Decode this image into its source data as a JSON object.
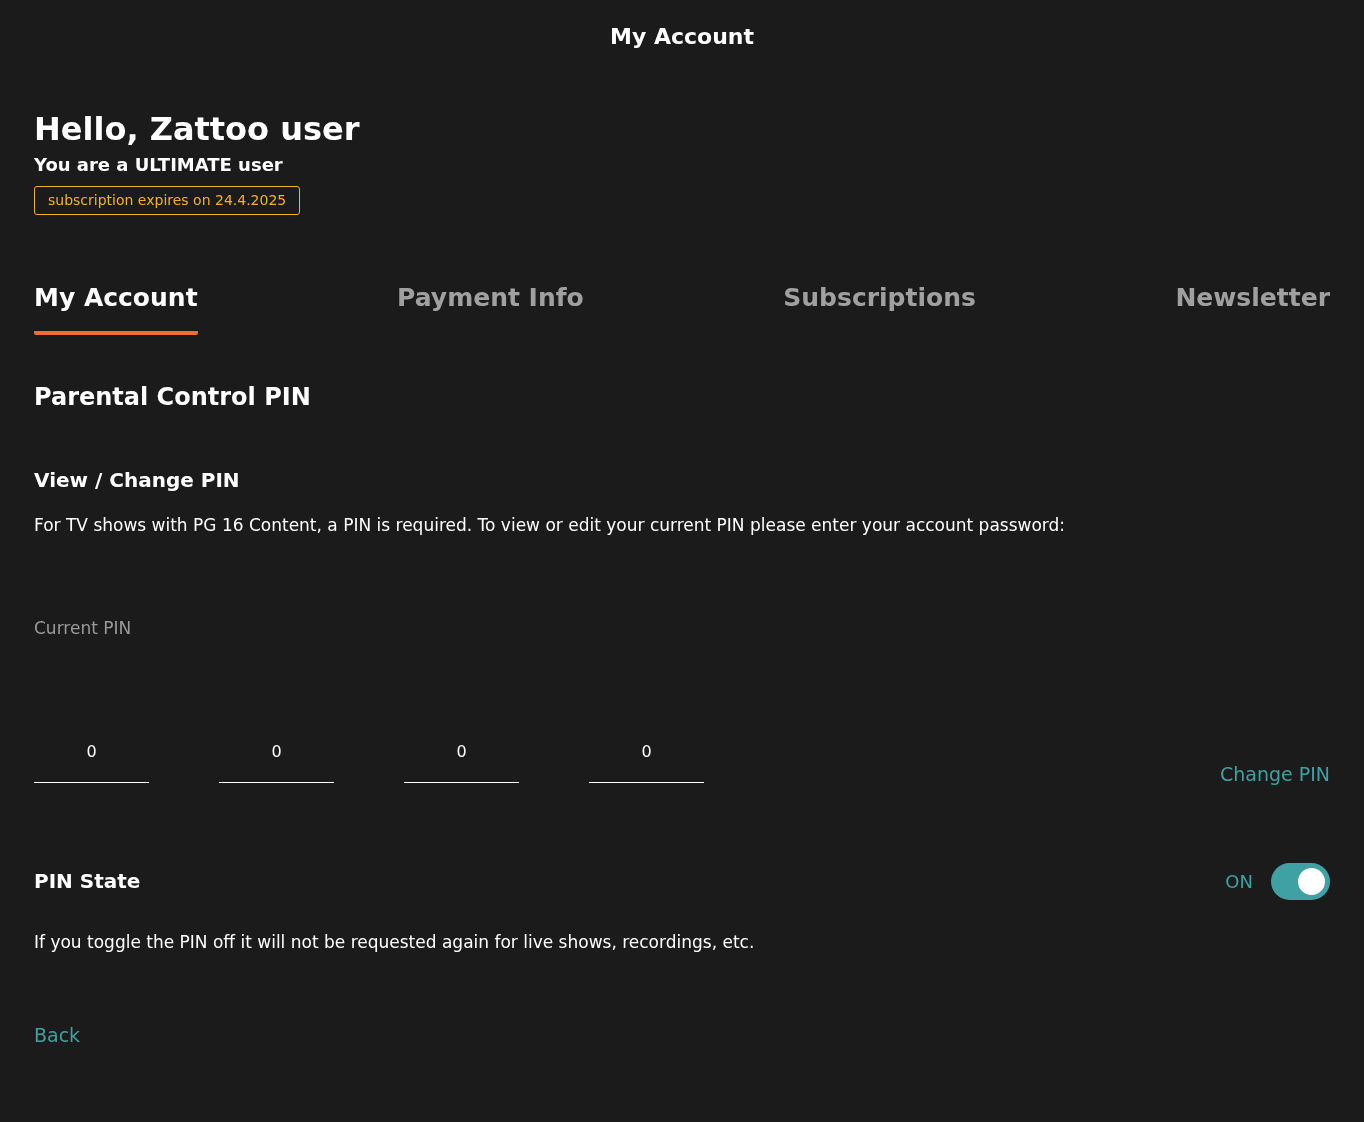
{
  "header": {
    "title": "My Account"
  },
  "greeting": {
    "title": "Hello, Zattoo user",
    "subtitle": "You are a ULTIMATE user",
    "badge": "subscription expires on 24.4.2025"
  },
  "tabs": [
    {
      "label": "My Account",
      "selected": true
    },
    {
      "label": "Payment Info",
      "selected": false
    },
    {
      "label": "Subscriptions",
      "selected": false
    },
    {
      "label": "Newsletter",
      "selected": false
    }
  ],
  "section": {
    "title": "Parental Control PIN",
    "subtitle": "View / Change PIN",
    "description": "For TV shows with PG 16 Content, a PIN is required. To view or edit your current PIN please enter your account password:",
    "pin_label": "Current PIN",
    "pin_digits": [
      "0",
      "0",
      "0",
      "0"
    ],
    "change_link": "Change PIN"
  },
  "pin_state": {
    "title": "PIN State",
    "state_label": "ON",
    "on": true,
    "description": "If you toggle the PIN off it will not be requested again for live shows, recordings, etc."
  },
  "back_link": "Back"
}
